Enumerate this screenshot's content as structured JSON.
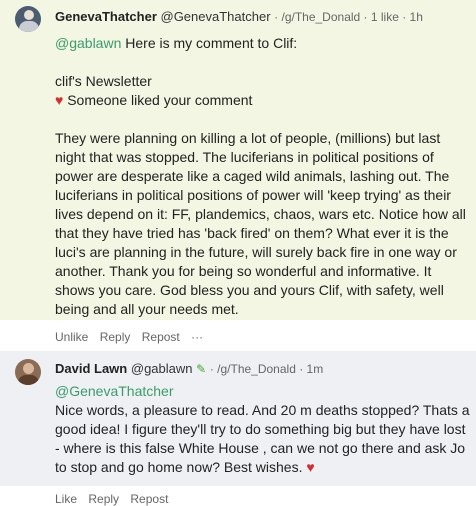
{
  "comment1": {
    "author": "GenevaThatcher",
    "handle": "@GenevaThatcher",
    "meta": "· /g/The_Donald · 1 like · 1h",
    "mention": "@gablawn",
    "intro": " Here is my comment to Clif:",
    "newsletter": "clif's Newsletter",
    "liked_text": "Someone liked your comment",
    "body": "They were planning on killing a lot of people, (millions) but last night that was stopped. The luciferians in political positions of power are desperate like a caged wild animals, lashing out. The luciferians in political positions of power will 'keep trying' as their lives depend on it: FF, plandemics, chaos, wars etc. Notice how all that they have tried has 'back fired' on them? What ever it is the luci's are planning in the future, will surely back fire in one way or another. Thank you for being so wonderful and informative. It shows you care. God bless you and yours Clif, with safety, well being and all your needs met.",
    "actions": {
      "unlike": "Unlike",
      "reply": "Reply",
      "repost": "Repost",
      "more": "···"
    }
  },
  "comment2": {
    "author": "David Lawn",
    "handle": "@gablawn",
    "meta": "· /g/The_Donald · 1m",
    "mention": "@GenevaThatcher",
    "body": "Nice words, a pleasure to read. And 20 m deaths stopped? Thats a good idea! I figure they'll try to do something big but they have lost - where is this false White House , can we not go there and ask Jo to stop and go home now? Best wishes.",
    "actions": {
      "like": "Like",
      "reply": "Reply",
      "repost": "Repost"
    }
  },
  "icons": {
    "heart": "heart-icon",
    "pencil": "pencil-icon",
    "avatar": "avatar-icon"
  },
  "colors": {
    "mention": "#3a9b6b",
    "heart": "#d32f2f",
    "post_highlight": "#f3f6e3",
    "reply_bg": "#eef0f4"
  }
}
